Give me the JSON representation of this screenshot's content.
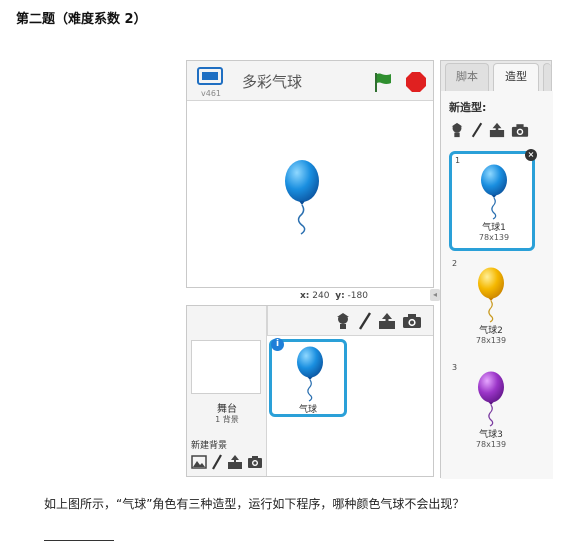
{
  "question": {
    "title": "第二题（难度系数 2）",
    "text": "如上图所示，“气球”角色有三种造型，运行如下程序，哪种颜色气球不会出现？"
  },
  "stage": {
    "project_title": "多彩气球",
    "version": "v461",
    "coords": {
      "x_label": "x:",
      "x_value": "240",
      "y_label": "y:",
      "y_value": "-180"
    }
  },
  "sprites": {
    "stage_label": "舞台",
    "backdrop_count": "1 背景",
    "new_backdrop_label": "新建背景",
    "items": [
      {
        "name": "气球"
      }
    ]
  },
  "tabs": {
    "scripts": "脚本",
    "costumes": "造型"
  },
  "costumes": {
    "new_costume_label": "新造型:",
    "items": [
      {
        "index": "1",
        "name": "气球1",
        "size": "78x139",
        "color": "#1a8fe0"
      },
      {
        "index": "2",
        "name": "气球2",
        "size": "78x139",
        "color": "#f5b800"
      },
      {
        "index": "3",
        "name": "气球3",
        "size": "78x139",
        "color": "#9b35c8"
      }
    ]
  },
  "icons": [
    "presentation-mode-icon",
    "green-flag-icon",
    "stop-icon",
    "paint-new-sprite-icon",
    "choose-from-library-icon",
    "upload-icon",
    "camera-icon",
    "info-icon",
    "delete-icon"
  ],
  "colors": {
    "selection": "#2aa0d8",
    "flag": "#2f8f2f",
    "stop": "#e02020"
  }
}
